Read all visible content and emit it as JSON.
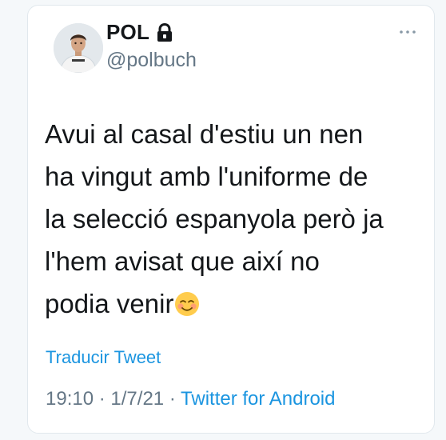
{
  "tweet": {
    "author": {
      "display_name": "POL",
      "handle": "@polbuch",
      "protected_icon": "lock-icon",
      "avatar_icon": "profile-photo"
    },
    "more_icon": "more-horizontal-icon",
    "text_lines": [
      "Avui al casal d'estiu un nen",
      "ha vingut amb l'uniforme de",
      "la selecció espanyola però ja",
      "l'hem avisat que així no",
      "podia venir"
    ],
    "text_emoji": "smiling-face-with-smiling-eyes-icon",
    "translate_label": "Traducir Tweet",
    "time": "19:10",
    "separator": "·",
    "date": "1/7/21",
    "source": "Twitter for Android"
  },
  "colors": {
    "background": "#f5f8fa",
    "card": "#ffffff",
    "text": "#14171a",
    "secondary": "#657786",
    "link": "#1b95e0"
  }
}
